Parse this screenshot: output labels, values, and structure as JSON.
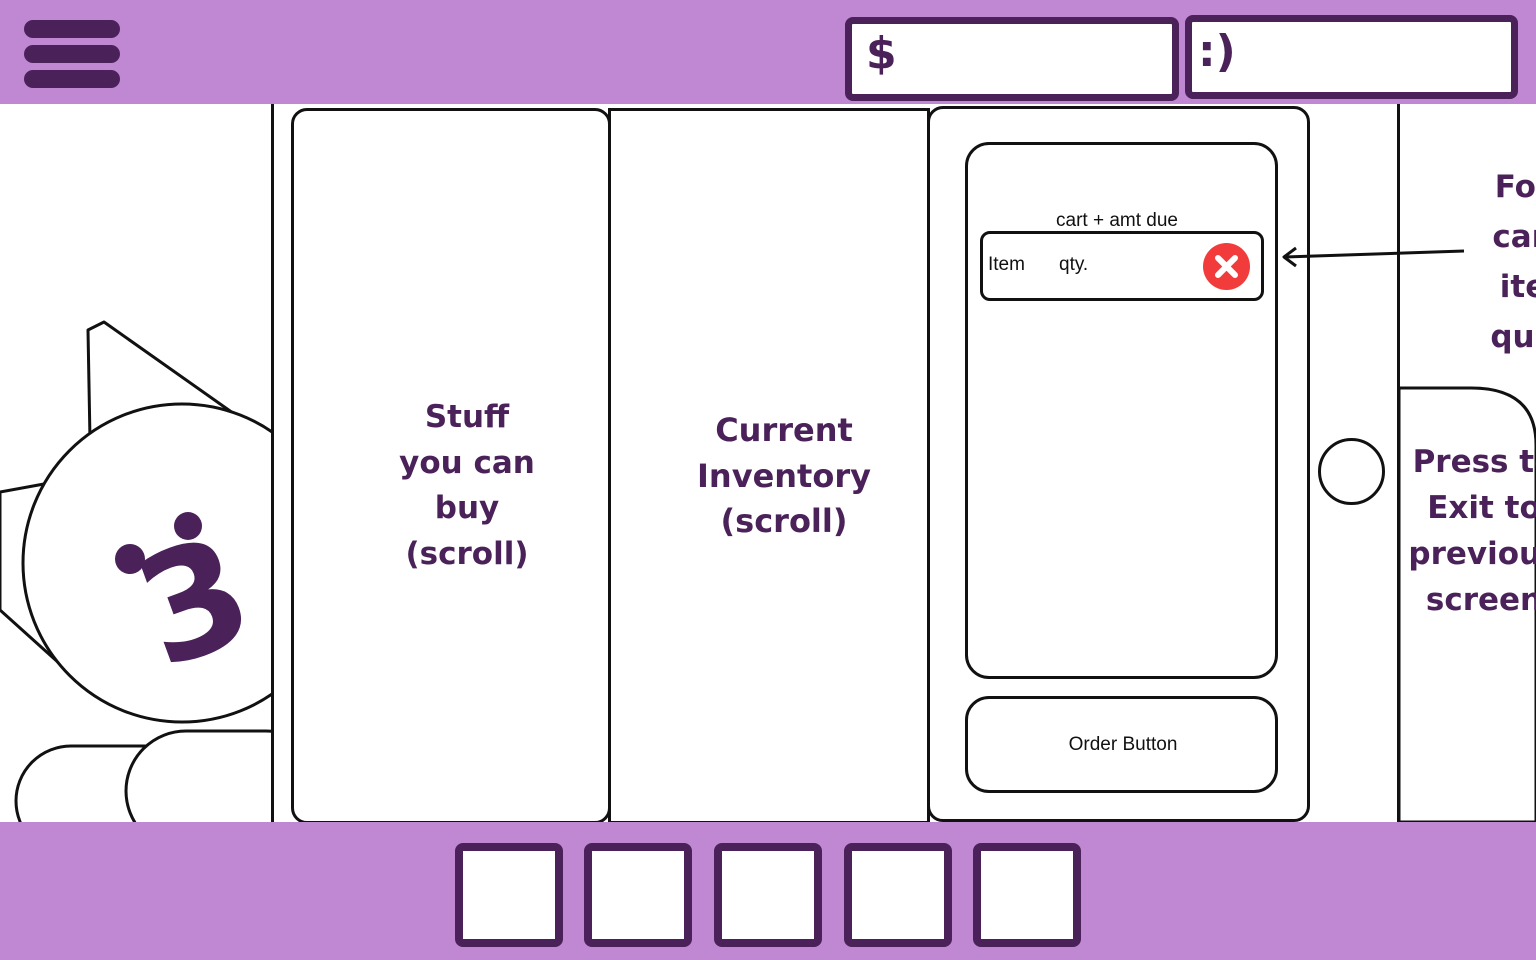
{
  "hud": {
    "money_symbol": "$",
    "mood_symbol": ":)"
  },
  "shop": {
    "buy_panel_label": "Stuff\nyou can\nbuy\n(scroll)",
    "inventory_panel_label": "Current\nInventory\n(scroll)"
  },
  "cart": {
    "title": "cart + amt due",
    "item_label": "Item",
    "qty_label": "qty.",
    "order_button_label": "Order Button"
  },
  "annotations": {
    "remove_note": "For\ncan\nite\nque",
    "exit_note": "Press to\nExit to\nprevious\nscreen"
  },
  "hotbar": {
    "slots": [
      "",
      "",
      "",
      "",
      ""
    ]
  },
  "colors": {
    "bar": "#c087d3",
    "accent": "#4a2259",
    "remove": "#f23c3c"
  }
}
